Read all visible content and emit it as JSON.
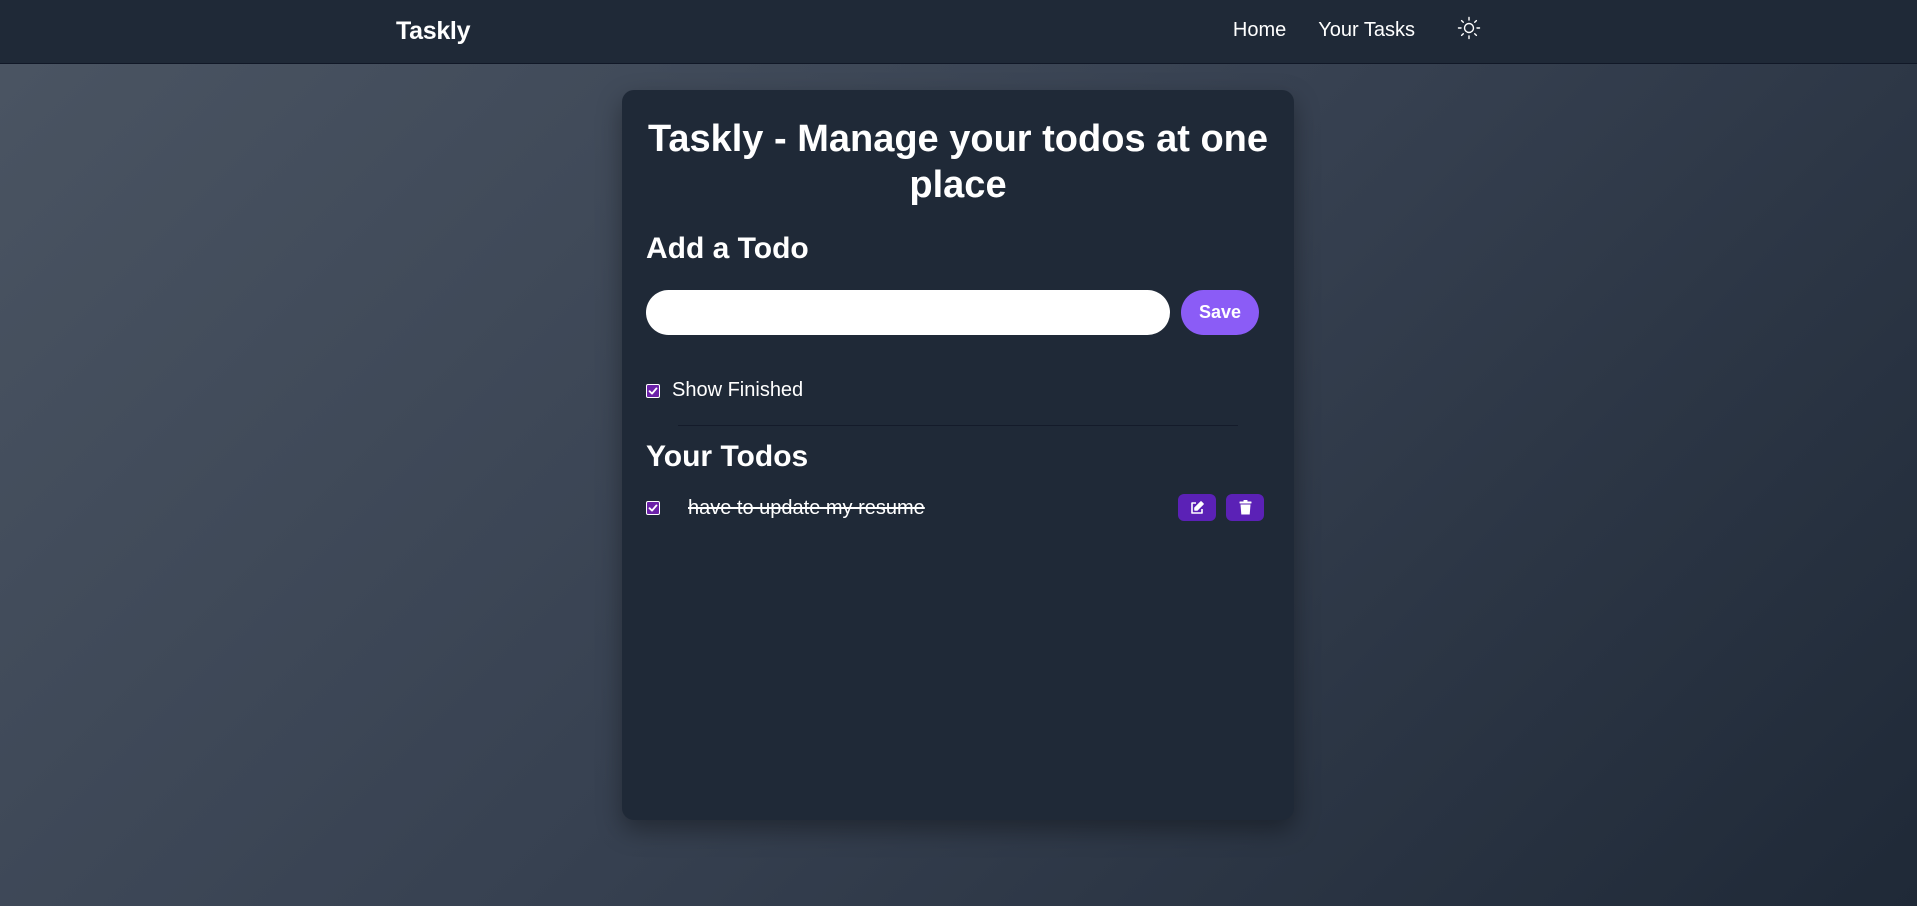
{
  "navbar": {
    "brand": "Taskly",
    "links": [
      "Home",
      "Your Tasks"
    ],
    "theme_icon": "sun-icon"
  },
  "card": {
    "title": "Taskly - Manage your todos at one place",
    "add_heading": "Add a Todo",
    "input": {
      "value": "",
      "placeholder": ""
    },
    "save_label": "Save",
    "show_finished": {
      "label": "Show Finished",
      "checked": true
    },
    "todos_heading": "Your Todos",
    "todos": [
      {
        "text": "have to update my resume",
        "completed": true,
        "edit_icon": "edit-icon",
        "delete_icon": "trash-icon"
      }
    ]
  },
  "colors": {
    "navbar_bg": "#1f2937",
    "card_bg": "#1f2937",
    "accent": "#8b5cf6",
    "icon_button_bg": "#5b21b6",
    "checkbox_bg": "#6b21a8"
  }
}
